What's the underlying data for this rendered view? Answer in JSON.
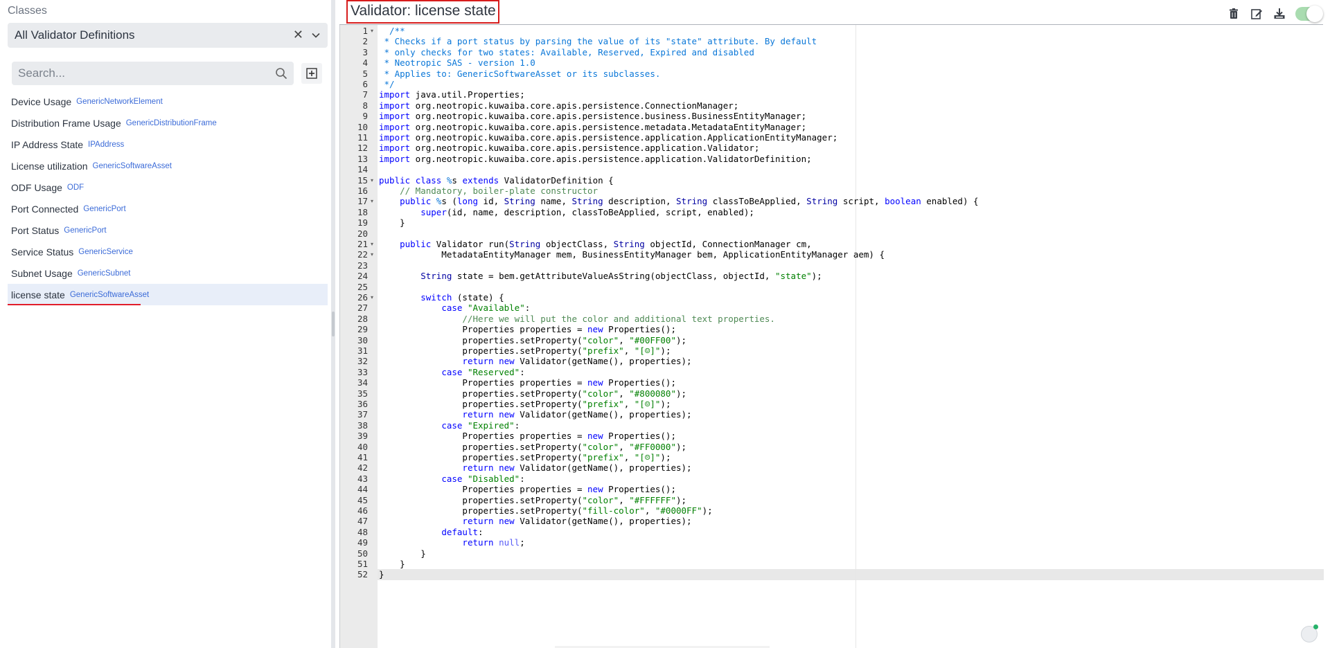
{
  "sidebar": {
    "section_title": "Classes",
    "filter_combo": {
      "value": "All Validator Definitions"
    },
    "search": {
      "placeholder": "Search..."
    },
    "items": [
      {
        "name": "Device Usage",
        "class": "GenericNetworkElement",
        "selected": false
      },
      {
        "name": "Distribution Frame Usage",
        "class": "GenericDistributionFrame",
        "selected": false
      },
      {
        "name": "IP Address State",
        "class": "IPAddress",
        "selected": false
      },
      {
        "name": "License utilization",
        "class": "GenericSoftwareAsset",
        "selected": false
      },
      {
        "name": "ODF Usage",
        "class": "ODF",
        "selected": false
      },
      {
        "name": "Port Connected",
        "class": "GenericPort",
        "selected": false
      },
      {
        "name": "Port Status",
        "class": "GenericPort",
        "selected": false
      },
      {
        "name": "Service Status",
        "class": "GenericService",
        "selected": false
      },
      {
        "name": "Subnet Usage",
        "class": "GenericSubnet",
        "selected": false
      },
      {
        "name": "license state",
        "class": "GenericSoftwareAsset",
        "selected": true
      }
    ]
  },
  "header": {
    "title": "Validator:  license state",
    "toolbar": [
      "trash-icon",
      "edit-icon",
      "download-icon",
      "enabled-toggle"
    ],
    "enabled": true
  },
  "editor": {
    "active_line": 52,
    "fold_lines": [
      1,
      15,
      17,
      21,
      22,
      26
    ],
    "lines": [
      [
        [
          "  /**",
          "cmt"
        ]
      ],
      [
        [
          " * Checks if a port status by parsing the value of its \"state\" attribute. By default",
          "cmt"
        ]
      ],
      [
        [
          " * only checks for two states: Available, Reserved, Expired and disabled",
          "cmt"
        ]
      ],
      [
        [
          " * Neotropic SAS - version 1.0",
          "cmt"
        ]
      ],
      [
        [
          " * Applies to: GenericSoftwareAsset or its subclasses.",
          "cmt"
        ]
      ],
      [
        [
          " */",
          "cmt"
        ]
      ],
      [
        [
          "import",
          "kw"
        ],
        [
          " java.util.Properties;",
          "plain"
        ]
      ],
      [
        [
          "import",
          "kw"
        ],
        [
          " org.neotropic.kuwaiba.core.apis.persistence.ConnectionManager;",
          "plain"
        ]
      ],
      [
        [
          "import",
          "kw"
        ],
        [
          " org.neotropic.kuwaiba.core.apis.persistence.business.BusinessEntityManager;",
          "plain"
        ]
      ],
      [
        [
          "import",
          "kw"
        ],
        [
          " org.neotropic.kuwaiba.core.apis.persistence.metadata.MetadataEntityManager;",
          "plain"
        ]
      ],
      [
        [
          "import",
          "kw"
        ],
        [
          " org.neotropic.kuwaiba.core.apis.persistence.application.ApplicationEntityManager;",
          "plain"
        ]
      ],
      [
        [
          "import",
          "kw"
        ],
        [
          " org.neotropic.kuwaiba.core.apis.persistence.application.Validator;",
          "plain"
        ]
      ],
      [
        [
          "import",
          "kw"
        ],
        [
          " org.neotropic.kuwaiba.core.apis.persistence.application.ValidatorDefinition;",
          "plain"
        ]
      ],
      [
        [
          "",
          "plain"
        ]
      ],
      [
        [
          "public",
          "kw"
        ],
        [
          " ",
          "plain"
        ],
        [
          "class",
          "kw"
        ],
        [
          " ",
          "plain"
        ],
        [
          "%",
          "cmt"
        ],
        [
          "s ",
          "plain"
        ],
        [
          "extends",
          "kw"
        ],
        [
          " ValidatorDefinition {",
          "plain"
        ]
      ],
      [
        [
          "    // Mandatory, boiler-plate constructor",
          "lcmt"
        ]
      ],
      [
        [
          "    ",
          "plain"
        ],
        [
          "public",
          "kw"
        ],
        [
          " ",
          "plain"
        ],
        [
          "%",
          "cmt"
        ],
        [
          "s (",
          "plain"
        ],
        [
          "long",
          "kw"
        ],
        [
          " id, ",
          "plain"
        ],
        [
          "String",
          "type"
        ],
        [
          " name, ",
          "plain"
        ],
        [
          "String",
          "type"
        ],
        [
          " description, ",
          "plain"
        ],
        [
          "String",
          "type"
        ],
        [
          " classToBeApplied, ",
          "plain"
        ],
        [
          "String",
          "type"
        ],
        [
          " script, ",
          "plain"
        ],
        [
          "boolean",
          "kw"
        ],
        [
          " enabled) {",
          "plain"
        ]
      ],
      [
        [
          "        ",
          "plain"
        ],
        [
          "super",
          "kw"
        ],
        [
          "(id, name, description, classToBeApplied, script, enabled);",
          "plain"
        ]
      ],
      [
        [
          "    }",
          "plain"
        ]
      ],
      [
        [
          "",
          "plain"
        ]
      ],
      [
        [
          "    ",
          "plain"
        ],
        [
          "public",
          "kw"
        ],
        [
          " Validator run(",
          "plain"
        ],
        [
          "String",
          "type"
        ],
        [
          " objectClass, ",
          "plain"
        ],
        [
          "String",
          "type"
        ],
        [
          " objectId, ConnectionManager cm,",
          "plain"
        ]
      ],
      [
        [
          "            MetadataEntityManager mem, BusinessEntityManager bem, ApplicationEntityManager aem) {",
          "plain"
        ]
      ],
      [
        [
          "",
          "plain"
        ]
      ],
      [
        [
          "        ",
          "plain"
        ],
        [
          "String",
          "type"
        ],
        [
          " state = bem.getAttributeValueAsString(objectClass, objectId, ",
          "plain"
        ],
        [
          "\"state\"",
          "str"
        ],
        [
          ");",
          "plain"
        ]
      ],
      [
        [
          "",
          "plain"
        ]
      ],
      [
        [
          "        ",
          "plain"
        ],
        [
          "switch",
          "kw"
        ],
        [
          " (state) {",
          "plain"
        ]
      ],
      [
        [
          "            ",
          "plain"
        ],
        [
          "case",
          "kw"
        ],
        [
          " ",
          "plain"
        ],
        [
          "\"Available\"",
          "str"
        ],
        [
          ":",
          "plain"
        ]
      ],
      [
        [
          "                //Here we will put the color and additional text properties.",
          "lcmt"
        ]
      ],
      [
        [
          "                Properties properties = ",
          "plain"
        ],
        [
          "new",
          "kw"
        ],
        [
          " Properties();",
          "plain"
        ]
      ],
      [
        [
          "                properties.setProperty(",
          "plain"
        ],
        [
          "\"color\"",
          "str"
        ],
        [
          ", ",
          "plain"
        ],
        [
          "\"#00FF00\"",
          "str"
        ],
        [
          ");",
          "plain"
        ]
      ],
      [
        [
          "                properties.setProperty(",
          "plain"
        ],
        [
          "\"prefix\"",
          "str"
        ],
        [
          ", ",
          "plain"
        ],
        [
          "\"[☺]\"",
          "str"
        ],
        [
          ");",
          "plain"
        ]
      ],
      [
        [
          "                ",
          "plain"
        ],
        [
          "return",
          "kw"
        ],
        [
          " ",
          "plain"
        ],
        [
          "new",
          "kw"
        ],
        [
          " Validator(getName(), properties);",
          "plain"
        ]
      ],
      [
        [
          "            ",
          "plain"
        ],
        [
          "case",
          "kw"
        ],
        [
          " ",
          "plain"
        ],
        [
          "\"Reserved\"",
          "str"
        ],
        [
          ":",
          "plain"
        ]
      ],
      [
        [
          "                Properties properties = ",
          "plain"
        ],
        [
          "new",
          "kw"
        ],
        [
          " Properties();",
          "plain"
        ]
      ],
      [
        [
          "                properties.setProperty(",
          "plain"
        ],
        [
          "\"color\"",
          "str"
        ],
        [
          ", ",
          "plain"
        ],
        [
          "\"#800080\"",
          "str"
        ],
        [
          ");",
          "plain"
        ]
      ],
      [
        [
          "                properties.setProperty(",
          "plain"
        ],
        [
          "\"prefix\"",
          "str"
        ],
        [
          ", ",
          "plain"
        ],
        [
          "\"[☺]\"",
          "str"
        ],
        [
          ");",
          "plain"
        ]
      ],
      [
        [
          "                ",
          "plain"
        ],
        [
          "return",
          "kw"
        ],
        [
          " ",
          "plain"
        ],
        [
          "new",
          "kw"
        ],
        [
          " Validator(getName(), properties);",
          "plain"
        ]
      ],
      [
        [
          "            ",
          "plain"
        ],
        [
          "case",
          "kw"
        ],
        [
          " ",
          "plain"
        ],
        [
          "\"Expired\"",
          "str"
        ],
        [
          ":",
          "plain"
        ]
      ],
      [
        [
          "                Properties properties = ",
          "plain"
        ],
        [
          "new",
          "kw"
        ],
        [
          " Properties();",
          "plain"
        ]
      ],
      [
        [
          "                properties.setProperty(",
          "plain"
        ],
        [
          "\"color\"",
          "str"
        ],
        [
          ", ",
          "plain"
        ],
        [
          "\"#FF0000\"",
          "str"
        ],
        [
          ");",
          "plain"
        ]
      ],
      [
        [
          "                properties.setProperty(",
          "plain"
        ],
        [
          "\"prefix\"",
          "str"
        ],
        [
          ", ",
          "plain"
        ],
        [
          "\"[☹]\"",
          "str"
        ],
        [
          ");",
          "plain"
        ]
      ],
      [
        [
          "                ",
          "plain"
        ],
        [
          "return",
          "kw"
        ],
        [
          " ",
          "plain"
        ],
        [
          "new",
          "kw"
        ],
        [
          " Validator(getName(), properties);",
          "plain"
        ]
      ],
      [
        [
          "            ",
          "plain"
        ],
        [
          "case",
          "kw"
        ],
        [
          " ",
          "plain"
        ],
        [
          "\"Disabled\"",
          "str"
        ],
        [
          ":",
          "plain"
        ]
      ],
      [
        [
          "                Properties properties = ",
          "plain"
        ],
        [
          "new",
          "kw"
        ],
        [
          " Properties();",
          "plain"
        ]
      ],
      [
        [
          "                properties.setProperty(",
          "plain"
        ],
        [
          "\"color\"",
          "str"
        ],
        [
          ", ",
          "plain"
        ],
        [
          "\"#FFFFFF\"",
          "str"
        ],
        [
          ");",
          "plain"
        ]
      ],
      [
        [
          "                properties.setProperty(",
          "plain"
        ],
        [
          "\"fill-color\"",
          "str"
        ],
        [
          ", ",
          "plain"
        ],
        [
          "\"#0000FF\"",
          "str"
        ],
        [
          ");",
          "plain"
        ]
      ],
      [
        [
          "                ",
          "plain"
        ],
        [
          "return",
          "kw"
        ],
        [
          " ",
          "plain"
        ],
        [
          "new",
          "kw"
        ],
        [
          " Validator(getName(), properties);",
          "plain"
        ]
      ],
      [
        [
          "            ",
          "plain"
        ],
        [
          "default",
          "kw"
        ],
        [
          ":",
          "plain"
        ]
      ],
      [
        [
          "                ",
          "plain"
        ],
        [
          "return",
          "kw"
        ],
        [
          " ",
          "plain"
        ],
        [
          "null",
          "null"
        ],
        [
          ";",
          "plain"
        ]
      ],
      [
        [
          "        }",
          "plain"
        ]
      ],
      [
        [
          "    }",
          "plain"
        ]
      ],
      [
        [
          "}",
          "plain"
        ]
      ]
    ]
  },
  "colors": {
    "selected_underline": "#e11d2a",
    "title_border": "#d71c1c",
    "class_link": "#3b6bd8",
    "toggle_on": "#a9dcb0",
    "keyword": "#0000ff",
    "string": "#008000",
    "doc_comment": "#0a77d8"
  }
}
